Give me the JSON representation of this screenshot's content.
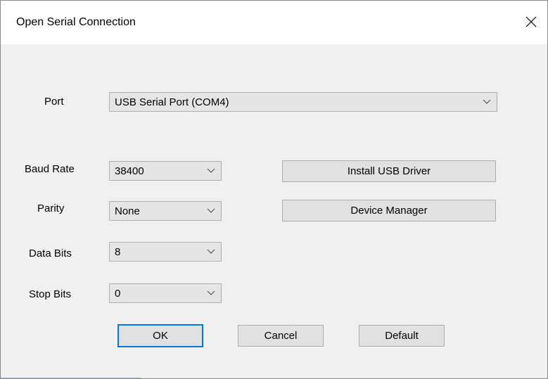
{
  "window": {
    "title": "Open Serial Connection"
  },
  "port": {
    "label": "Port",
    "value": "USB Serial Port (COM4)"
  },
  "baud_rate": {
    "label": "Baud Rate",
    "value": "38400"
  },
  "parity": {
    "label": "Parity",
    "value": "None"
  },
  "data_bits": {
    "label": "Data Bits",
    "value": "8"
  },
  "stop_bits": {
    "label": "Stop Bits",
    "value": "0"
  },
  "buttons": {
    "install_usb_driver": "Install USB Driver",
    "device_manager": "Device Manager",
    "ok": "OK",
    "cancel": "Cancel",
    "default": "Default"
  },
  "icons": {
    "close": "close-icon",
    "dropdown": "chevron-down-icon"
  },
  "colors": {
    "focus_border": "#0078d7",
    "button_bg": "#e1e1e1",
    "dialog_bg": "#f0f0f0"
  }
}
